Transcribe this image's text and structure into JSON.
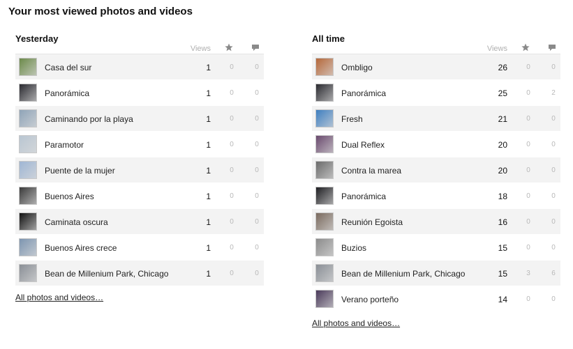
{
  "page_title": "Your most viewed photos and videos",
  "icons": {
    "favorites": "star-icon",
    "comments": "comment-icon"
  },
  "panels": [
    {
      "title": "Yesterday",
      "views_label": "Views",
      "link": "All photos and videos…",
      "rows": [
        {
          "title": "Casa del sur",
          "views": "1",
          "favs": "0",
          "comments": "0",
          "thumb": "#6c8a4a"
        },
        {
          "title": "Panorámica",
          "views": "1",
          "favs": "0",
          "comments": "0",
          "thumb": "#2a2a30"
        },
        {
          "title": "Caminando por la playa",
          "views": "1",
          "favs": "0",
          "comments": "0",
          "thumb": "#8fa4b8"
        },
        {
          "title": "Paramotor",
          "views": "1",
          "favs": "0",
          "comments": "0",
          "thumb": "#b9c6d2"
        },
        {
          "title": "Puente de la mujer",
          "views": "1",
          "favs": "0",
          "comments": "0",
          "thumb": "#9fb6d4"
        },
        {
          "title": "Buenos Aires",
          "views": "1",
          "favs": "0",
          "comments": "0",
          "thumb": "#3a3a3a"
        },
        {
          "title": "Caminata oscura",
          "views": "1",
          "favs": "0",
          "comments": "0",
          "thumb": "#101010"
        },
        {
          "title": "Buenos Aires crece",
          "views": "1",
          "favs": "0",
          "comments": "0",
          "thumb": "#7d95b0"
        },
        {
          "title": "Bean de Millenium Park, Chicago",
          "views": "1",
          "favs": "0",
          "comments": "0",
          "thumb": "#8a8f96"
        }
      ]
    },
    {
      "title": "All time",
      "views_label": "Views",
      "link": "All photos and videos…",
      "rows": [
        {
          "title": "Ombligo",
          "views": "26",
          "favs": "0",
          "comments": "0",
          "thumb": "#b5683a"
        },
        {
          "title": "Panorámica",
          "views": "25",
          "favs": "0",
          "comments": "2",
          "thumb": "#2a2a30"
        },
        {
          "title": "Fresh",
          "views": "21",
          "favs": "0",
          "comments": "0",
          "thumb": "#3f7fc0"
        },
        {
          "title": "Dual Reflex",
          "views": "20",
          "favs": "0",
          "comments": "0",
          "thumb": "#6a4a6e"
        },
        {
          "title": "Contra la marea",
          "views": "20",
          "favs": "0",
          "comments": "0",
          "thumb": "#6b6b6b"
        },
        {
          "title": "Panorámica",
          "views": "18",
          "favs": "0",
          "comments": "0",
          "thumb": "#1e1e22"
        },
        {
          "title": "Reunión Egoista",
          "views": "16",
          "favs": "0",
          "comments": "0",
          "thumb": "#7a6a5e"
        },
        {
          "title": "Buzios",
          "views": "15",
          "favs": "0",
          "comments": "0",
          "thumb": "#8c8c8c"
        },
        {
          "title": "Bean de Millenium Park, Chicago",
          "views": "15",
          "favs": "3",
          "comments": "6",
          "thumb": "#8a8f96"
        },
        {
          "title": "Verano porteño",
          "views": "14",
          "favs": "0",
          "comments": "0",
          "thumb": "#4a3a5a"
        }
      ]
    }
  ]
}
